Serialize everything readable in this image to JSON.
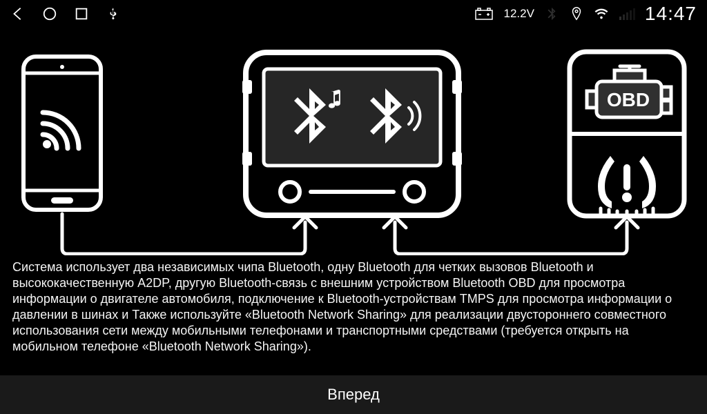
{
  "status": {
    "battery_voltage": "12.2V",
    "clock": "14:47"
  },
  "obd_label": "OBD",
  "description": "Система использует два независимых чипа Bluetooth, одну Bluetooth для четких вызовов Bluetooth и высококачественную A2DP, другую Bluetooth-связь с внешним устройством Bluetooth OBD для просмотра информации о двигателе автомобиля, подключение к Bluetooth-устройствам TMPS для просмотра информации о давлении в шинах и Также используйте «Bluetooth Network Sharing» для реализации двустороннего совместного использования сети между мобильными телефонами и транспортными средствами (требуется открыть на мобильном телефоне «Bluetooth Network Sharing»).",
  "footer": {
    "next_label": "Вперед"
  }
}
